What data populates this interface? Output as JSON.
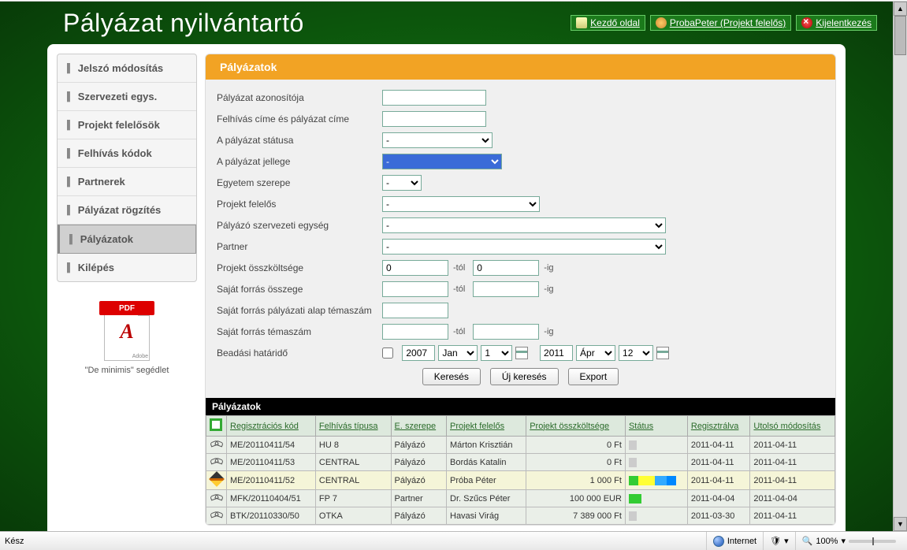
{
  "app": {
    "title": "Pályázat nyilvántartó"
  },
  "headerLinks": {
    "home": "Kezdő oldal",
    "user": "ProbaPeter (Projekt felelős)",
    "logout": "Kijelentkezés"
  },
  "sidebar": {
    "items": [
      {
        "label": "Jelszó módosítás"
      },
      {
        "label": "Szervezeti egys."
      },
      {
        "label": "Projekt felelősök"
      },
      {
        "label": "Felhívás kódok"
      },
      {
        "label": "Partnerek"
      },
      {
        "label": "Pályázat rögzítés"
      },
      {
        "label": "Pályázatok",
        "active": true
      },
      {
        "label": "Kilépés"
      }
    ],
    "pdf": {
      "banner": "PDF",
      "adobe": "Adobe",
      "caption": "\"De minimis\" segédlet"
    }
  },
  "card": {
    "title": "Pályázatok"
  },
  "form": {
    "labels": {
      "id": "Pályázat azonosítója",
      "titleSearch": "Felhívás címe és pályázat címe",
      "status": "A pályázat státusa",
      "type": "A pályázat jellege",
      "role": "Egyetem szerepe",
      "supervisor": "Projekt felelős",
      "orgunit": "Pályázó szervezeti egység",
      "partner": "Partner",
      "totalCost": "Projekt összköltsége",
      "ownFunds": "Saját forrás összege",
      "ownFundsTopic": "Saját forrás pályázati alap témaszám",
      "ownFundsTopicNum": "Saját forrás témaszám",
      "deadline": "Beadási határidő"
    },
    "placeholders": {
      "dash": "-"
    },
    "values": {
      "costFrom": "0",
      "costTo": "0",
      "yearFrom": "2007",
      "monthFrom": "Jan",
      "dayFrom": "1",
      "yearTo": "2011",
      "monthTo": "Ápr",
      "dayTo": "12"
    },
    "suffix": {
      "from": "-tól",
      "to": "-ig"
    },
    "buttons": {
      "search": "Keresés",
      "newSearch": "Új keresés",
      "export": "Export"
    }
  },
  "table": {
    "title": "Pályázatok",
    "headers": {
      "reg": "Regisztrációs kód",
      "callType": "Felhívás típusa",
      "role": "E. szerepe",
      "supervisor": "Projekt felelős",
      "cost": "Projekt összköltsége",
      "status": "Státus",
      "registered": "Regisztrálva",
      "modified": "Utolsó módosítás"
    },
    "rows": [
      {
        "action": "keys",
        "reg": "ME/20110411/54",
        "call": "HU 8",
        "role": "Pályázó",
        "sup": "Márton Krisztián",
        "cost": "0 Ft",
        "status": "grey",
        "regd": "2011-04-11",
        "mod": "2011-04-11"
      },
      {
        "action": "keys",
        "reg": "ME/20110411/53",
        "call": "CENTRAL",
        "role": "Pályázó",
        "sup": "Bordás Katalin",
        "cost": "0 Ft",
        "status": "grey",
        "regd": "2011-04-11",
        "mod": "2011-04-11"
      },
      {
        "action": "pencil",
        "reg": "ME/20110411/52",
        "call": "CENTRAL",
        "role": "Pályázó",
        "sup": "Próba Péter",
        "cost": "1 000 Ft",
        "status": "multi",
        "regd": "2011-04-11",
        "mod": "2011-04-11",
        "highlight": true
      },
      {
        "action": "keys",
        "reg": "MFK/20110404/51",
        "call": "FP 7",
        "role": "Partner",
        "sup": "Dr. Szűcs Péter",
        "cost": "100 000 EUR",
        "status": "green",
        "regd": "2011-04-04",
        "mod": "2011-04-04"
      },
      {
        "action": "keys",
        "reg": "BTK/20110330/50",
        "call": "OTKA",
        "role": "Pályázó",
        "sup": "Havasi Virág",
        "cost": "7 389 000 Ft",
        "status": "grey",
        "regd": "2011-03-30",
        "mod": "2011-04-11"
      }
    ]
  },
  "statusbar": {
    "ready": "Kész",
    "zone": "Internet",
    "zoom": "100%"
  }
}
